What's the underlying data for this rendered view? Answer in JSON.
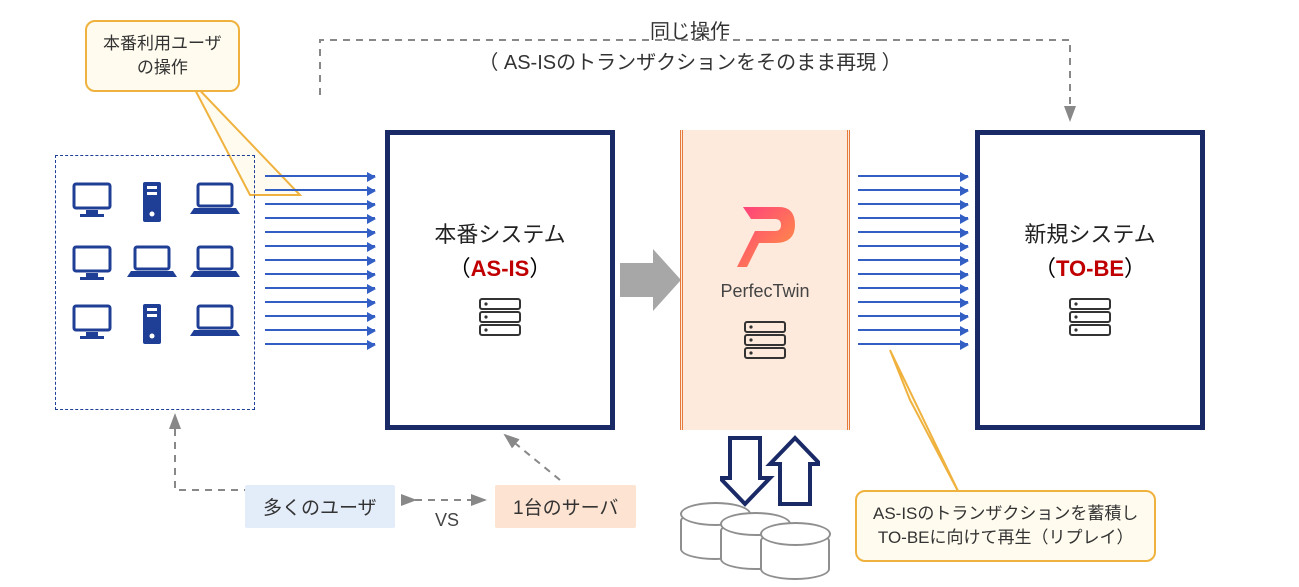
{
  "header": {
    "title1": "同じ操作",
    "title2": "（ AS-ISのトランザクションをそのまま再現 ）"
  },
  "callouts": {
    "user_ops": "本番利用ユーザ\nの操作",
    "replay": "AS-ISのトランザクションを蓄積し\nTO-BEに向けて再生（リプレイ）"
  },
  "systems": {
    "asis": {
      "line1": "本番システム",
      "tag": "AS-IS"
    },
    "perfectwin": {
      "name": "PerfecTwin"
    },
    "tobe": {
      "line1": "新規システム",
      "tag": "TO-BE"
    }
  },
  "bottom": {
    "many_users": "多くのユーザ",
    "vs": "VS",
    "one_server": "1台のサーバ"
  }
}
